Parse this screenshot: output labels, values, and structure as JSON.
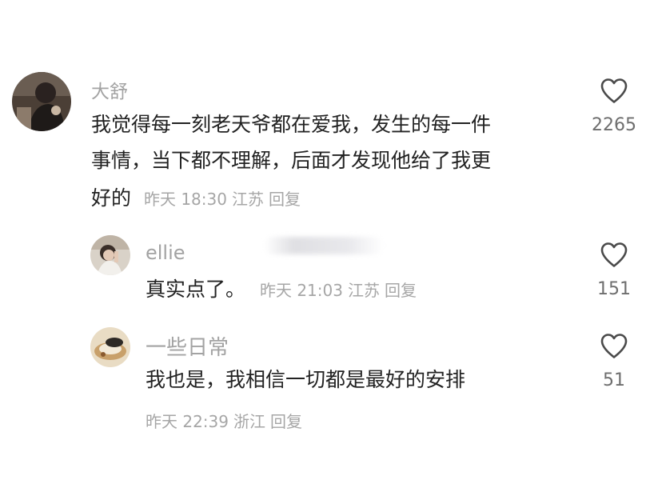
{
  "comments": [
    {
      "username": "大舒",
      "lines": [
        "我觉得每一刻老天爷都在爱我，发生的每一件",
        "事情，当下都不理解，后面才发现他给了我更"
      ],
      "last_line": "好的",
      "time": "昨天 18:30",
      "location": "江苏",
      "reply_label": "回复",
      "likes": "2265",
      "like_icon": "heart-outline-icon"
    },
    {
      "username": "ellie",
      "text": "真实点了。",
      "time": "昨天 21:03",
      "location": "江苏",
      "reply_label": "回复",
      "likes": "151",
      "like_icon": "heart-outline-icon"
    },
    {
      "username": "一些日常",
      "text": "我也是，我相信一切都是最好的安排",
      "time": "昨天 22:39",
      "location": "浙江",
      "reply_label": "回复",
      "likes": "51",
      "like_icon": "heart-outline-icon"
    }
  ],
  "colors": {
    "username": "#a3a3a3",
    "text": "#222222",
    "meta": "#a6a6a6",
    "icon": "#4a4a4a",
    "background": "#ffffff"
  }
}
